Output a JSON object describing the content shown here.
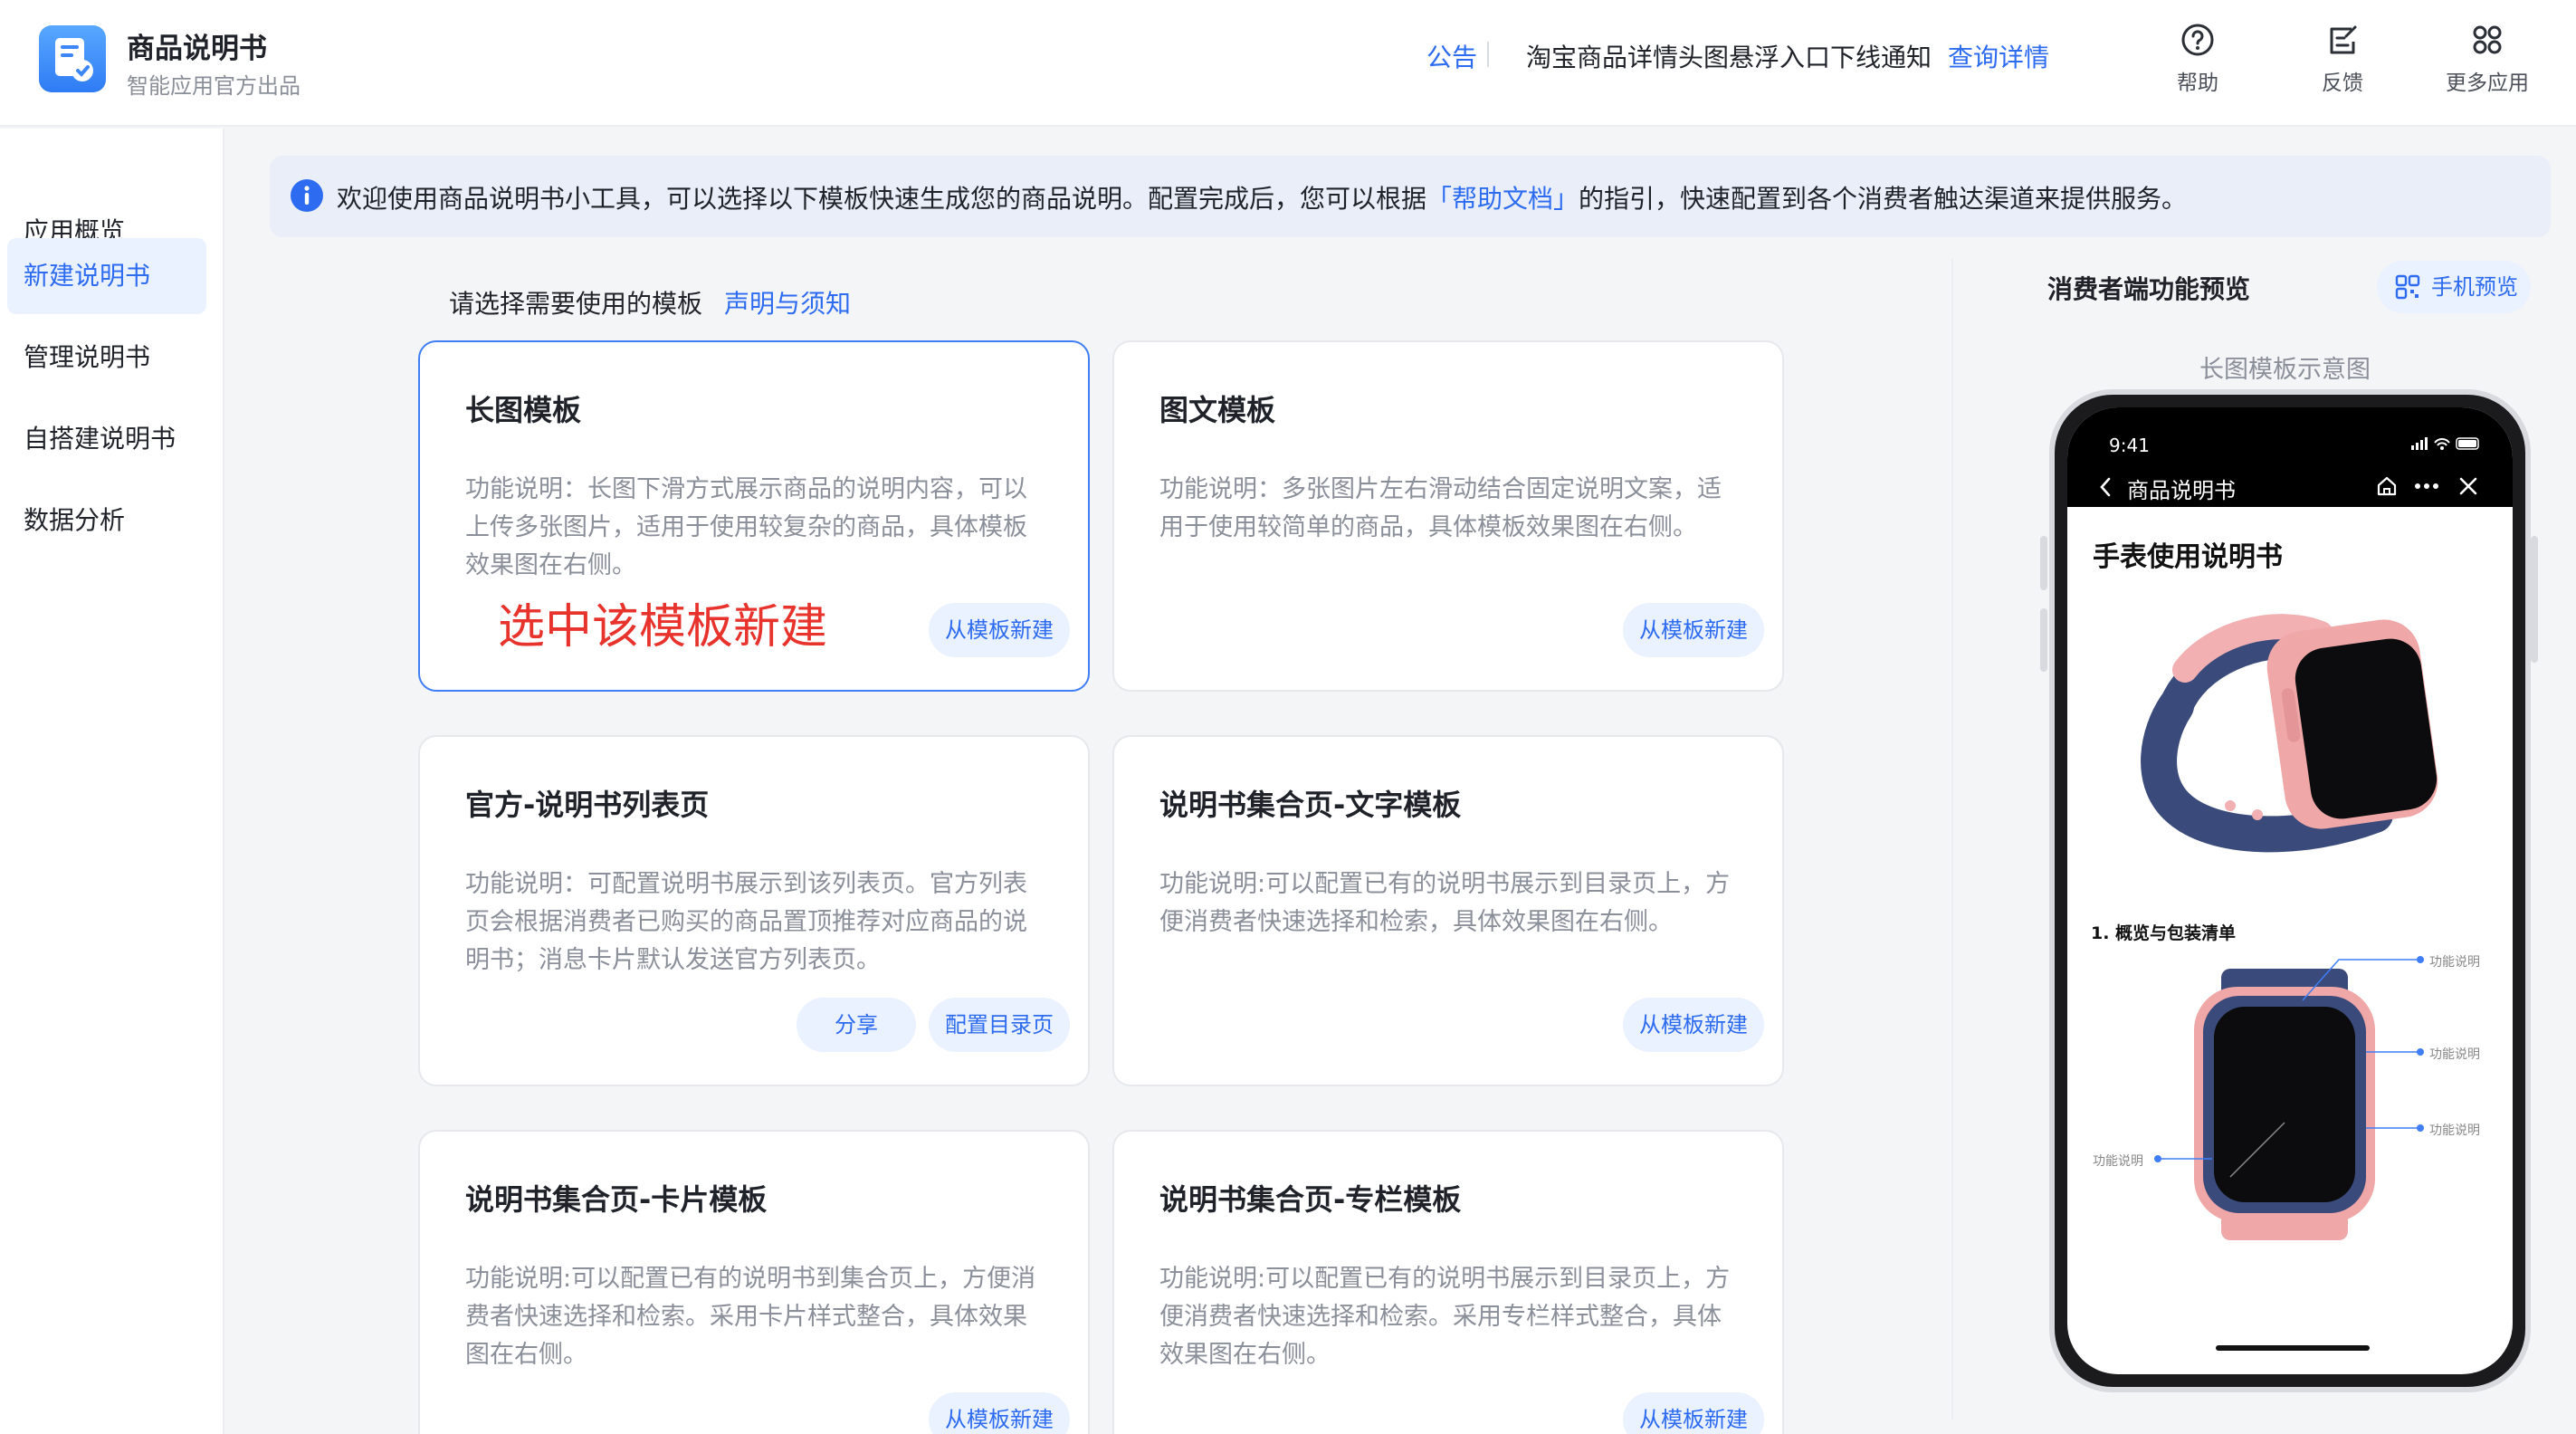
{
  "header": {
    "app_title": "商品说明书",
    "app_subtitle": "智能应用官方出品",
    "notice_label": "公告",
    "notice_text": "淘宝商品详情头图悬浮入口下线通知",
    "notice_link": "查询详情",
    "actions": [
      {
        "label": "帮助",
        "icon": "help-circle-icon"
      },
      {
        "label": "反馈",
        "icon": "feedback-edit-icon"
      },
      {
        "label": "更多应用",
        "icon": "apps-grid-icon"
      }
    ]
  },
  "sidebar": {
    "items": [
      {
        "label": "应用概览",
        "active": false
      },
      {
        "label": "新建说明书",
        "active": true
      },
      {
        "label": "管理说明书",
        "active": false
      },
      {
        "label": "自搭建说明书",
        "active": false
      },
      {
        "label": "数据分析",
        "active": false
      }
    ]
  },
  "banner": {
    "text_before": "欢迎使用商品说明书小工具，可以选择以下模板快速生成您的商品说明。配置完成后，您可以根据",
    "link": "「帮助文档」",
    "text_after": "的指引，快速配置到各个消费者触达渠道来提供服务。"
  },
  "templates": {
    "heading": "请选择需要使用的模板",
    "heading_link": "声明与须知",
    "cards": [
      {
        "title": "长图模板",
        "desc": "功能说明：长图下滑方式展示商品的说明内容，可以上传多张图片，适用于使用较复杂的商品，具体模板效果图在右侧。",
        "buttons": [
          "从模板新建"
        ],
        "selected": true,
        "annotation": "选中该模板新建"
      },
      {
        "title": "图文模板",
        "desc": "功能说明：多张图片左右滑动结合固定说明文案，适用于使用较简单的商品，具体模板效果图在右侧。",
        "buttons": [
          "从模板新建"
        ],
        "selected": false
      },
      {
        "title": "官方-说明书列表页",
        "desc": "功能说明：可配置说明书展示到该列表页。官方列表页会根据消费者已购买的商品置顶推荐对应商品的说明书；消息卡片默认发送官方列表页。",
        "buttons": [
          "分享",
          "配置目录页"
        ],
        "selected": false
      },
      {
        "title": "说明书集合页-文字模板",
        "desc": "功能说明:可以配置已有的说明书展示到目录页上，方便消费者快速选择和检索，具体效果图在右侧。",
        "buttons": [
          "从模板新建"
        ],
        "selected": false
      },
      {
        "title": "说明书集合页-卡片模板",
        "desc": "功能说明:可以配置已有的说明书到集合页上，方便消费者快速选择和检索。采用卡片样式整合，具体效果图在右侧。",
        "buttons": [
          "从模板新建"
        ],
        "selected": false
      },
      {
        "title": "说明书集合页-专栏模板",
        "desc": "功能说明:可以配置已有的说明书展示到目录页上，方便消费者快速选择和检索。采用专栏样式整合，具体效果图在右侧。",
        "buttons": [
          "从模板新建"
        ],
        "selected": false
      }
    ]
  },
  "preview": {
    "title": "消费者端功能预览",
    "phone_button": "手机预览",
    "subtitle": "长图模板示意图",
    "phone": {
      "time": "9:41",
      "nav_title": "商品说明书",
      "heading": "手表使用说明书",
      "section": "1. 概览与包装清单",
      "annotations": [
        "功能说明",
        "功能说明",
        "功能说明",
        "功能说明"
      ]
    }
  },
  "colors": {
    "accent": "#2d6cf0",
    "annotation_red": "#e8322c",
    "watch_pink": "#f0a7a8",
    "watch_strap": "#3a4a7a"
  }
}
